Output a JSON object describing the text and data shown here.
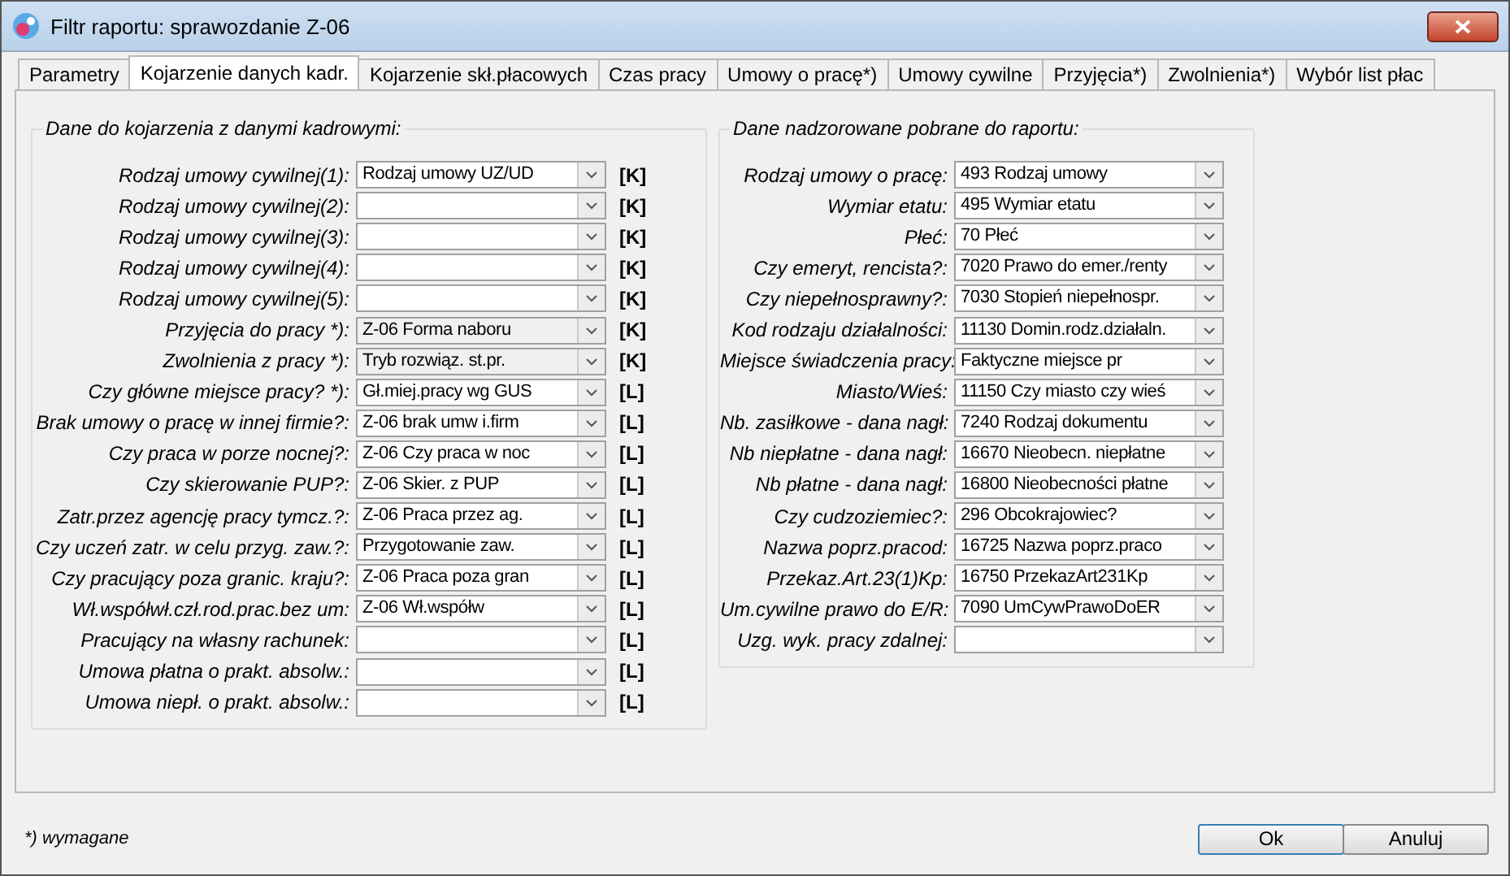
{
  "window": {
    "title": "Filtr raportu: sprawozdanie Z-06"
  },
  "tabs": [
    {
      "label": "Parametry",
      "selected": false
    },
    {
      "label": "Kojarzenie danych kadr.",
      "selected": true
    },
    {
      "label": "Kojarzenie skł.płacowych",
      "selected": false
    },
    {
      "label": "Czas pracy",
      "selected": false
    },
    {
      "label": "Umowy o pracę*)",
      "selected": false
    },
    {
      "label": "Umowy cywilne",
      "selected": false
    },
    {
      "label": "Przyjęcia*)",
      "selected": false
    },
    {
      "label": "Zwolnienia*)",
      "selected": false
    },
    {
      "label": "Wybór list płac",
      "selected": false
    }
  ],
  "left_group": {
    "title": "Dane do kojarzenia z danymi kadrowymi:",
    "rows": [
      {
        "label": "Rodzaj umowy cywilnej(1):",
        "value": "Rodzaj umowy UZ/UD",
        "tag": "[K]",
        "disabled": false
      },
      {
        "label": "Rodzaj umowy cywilnej(2):",
        "tag": "[K]",
        "disabled": false
      },
      {
        "label": "Rodzaj umowy cywilnej(3):",
        "tag": "[K]",
        "disabled": false
      },
      {
        "label": "Rodzaj umowy cywilnej(4):",
        "tag": "[K]",
        "disabled": false
      },
      {
        "label": "Rodzaj umowy cywilnej(5):",
        "tag": "[K]",
        "disabled": false
      },
      {
        "label": "Przyjęcia do pracy *):",
        "value": "Z-06 Forma naboru",
        "tag": "[K]",
        "disabled": true
      },
      {
        "label": "Zwolnienia z pracy *):",
        "value": "Tryb rozwiąz. st.pr.",
        "tag": "[K]",
        "disabled": true
      },
      {
        "label": "Czy główne miejsce pracy? *):",
        "value": "Gł.miej.pracy wg GUS",
        "tag": "[L]",
        "disabled": false
      },
      {
        "label": "Brak umowy o pracę w innej firmie?:",
        "value": "Z-06 brak umw i.firm",
        "tag": "[L]",
        "disabled": false
      },
      {
        "label": "Czy praca w porze nocnej?:",
        "value": "Z-06 Czy praca w noc",
        "tag": "[L]",
        "disabled": false
      },
      {
        "label": "Czy skierowanie PUP?:",
        "value": "Z-06 Skier. z PUP",
        "tag": "[L]",
        "disabled": false
      },
      {
        "label": "Zatr.przez agencję pracy tymcz.?:",
        "value": "Z-06 Praca przez ag.",
        "tag": "[L]",
        "disabled": false
      },
      {
        "label": "Czy uczeń zatr. w celu przyg. zaw.?:",
        "value": "Przygotowanie zaw.",
        "tag": "[L]",
        "disabled": false
      },
      {
        "label": "Czy pracujący poza granic. kraju?:",
        "value": "Z-06 Praca poza gran",
        "tag": "[L]",
        "disabled": false
      },
      {
        "label": "Wł.współwł.czł.rod.prac.bez um:",
        "value": "Z-06 Wł.współw",
        "tag": "[L]",
        "disabled": false
      },
      {
        "label": "Pracujący na własny rachunek:",
        "tag": "[L]",
        "disabled": false
      },
      {
        "label": "Umowa płatna o prakt. absolw.:",
        "tag": "[L]",
        "disabled": false
      },
      {
        "label": "Umowa niepł. o prakt. absolw.:",
        "tag": "[L]",
        "disabled": false
      }
    ]
  },
  "right_group": {
    "title": "Dane nadzorowane pobrane do raportu:",
    "rows": [
      {
        "label": "Rodzaj umowy o pracę:",
        "value": "493 Rodzaj umowy"
      },
      {
        "label": "Wymiar etatu:",
        "value": "495 Wymiar etatu"
      },
      {
        "label": "Płeć:",
        "value": "70 Płeć"
      },
      {
        "label": "Czy emeryt, rencista?:",
        "value": "7020 Prawo do emer./renty"
      },
      {
        "label": "Czy niepełnosprawny?:",
        "value": "7030 Stopień niepełnospr."
      },
      {
        "label": "Kod rodzaju działalności:",
        "value": "11130 Domin.rodz.działaln."
      },
      {
        "label": "Miejsce świadczenia pracy:",
        "value": "Faktyczne miejsce pr"
      },
      {
        "label": "Miasto/Wieś:",
        "value": "11150 Czy miasto czy wieś"
      },
      {
        "label": "Nb. zasiłkowe - dana nagł:",
        "value": "7240 Rodzaj dokumentu"
      },
      {
        "label": "Nb niepłatne - dana nagł:",
        "value": "16670 Nieobecn. niepłatne"
      },
      {
        "label": "Nb płatne - dana nagł:",
        "value": "16800 Nieobecności płatne"
      },
      {
        "label": "Czy cudzoziemiec?:",
        "value": "296 Obcokrajowiec?"
      },
      {
        "label": "Nazwa poprz.pracod:",
        "value": "16725 Nazwa poprz.praco"
      },
      {
        "label": "Przekaz.Art.23(1)Kp:",
        "value": "16750 PrzekazArt231Kp"
      },
      {
        "label": "Um.cywilne prawo do E/R:",
        "value": "7090 UmCywPrawoDoER"
      },
      {
        "label": "Uzg. wyk. pracy zdalnej:"
      }
    ]
  },
  "footer": {
    "note": "*) wymagane",
    "buttons": [
      "Ok",
      "Anuluj"
    ]
  }
}
